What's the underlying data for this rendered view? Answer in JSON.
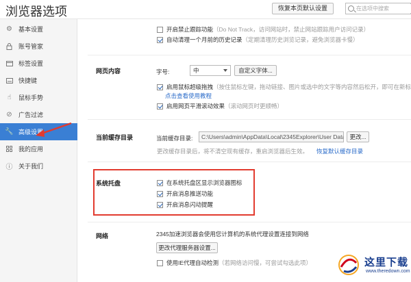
{
  "header": {
    "title": "浏览器选项",
    "reset_label": "恢复本页默认设置",
    "search_placeholder": "在选项中搜索"
  },
  "sidebar": {
    "items": [
      {
        "label": "基本设置",
        "icon": "gear-icon"
      },
      {
        "label": "账号管家",
        "icon": "lock-icon"
      },
      {
        "label": "标签设置",
        "icon": "tab-icon"
      },
      {
        "label": "快捷键",
        "icon": "keyboard-icon"
      },
      {
        "label": "鼠标手势",
        "icon": "hand-icon"
      },
      {
        "label": "广告过滤",
        "icon": "block-icon"
      },
      {
        "label": "高级设置",
        "icon": "wrench-icon"
      },
      {
        "label": "我的应用",
        "icon": "grid-icon"
      },
      {
        "label": "关于我们",
        "icon": "info-icon"
      }
    ],
    "active_index": 6
  },
  "privacy": {
    "dnt": {
      "checked": false,
      "label": "开启禁止跟踪功能",
      "hint": "（Do Not Track，访问网站时，禁止网站跟踪用户访问记录）"
    },
    "clear": {
      "checked": true,
      "label": "自动清理一个月前的历史记录",
      "hint": "（定期清理历史浏览记录，避免浏览器卡慢）"
    }
  },
  "webcontent": {
    "title": "网页内容",
    "font_label": "字号:",
    "font_value": "中",
    "custom_font": "自定义字体...",
    "drag": {
      "checked": true,
      "label": "启用鼠标超级拖拽",
      "hint": "（按住鼠标左键，拖动链接、图片或选中的文字等内容然后松开，即可在新标",
      "link": "点击查看使用教程"
    },
    "smooth": {
      "checked": true,
      "label": "启用网页平滑滚动效果",
      "hint": "（滚动网页时更顺畅）"
    }
  },
  "cache": {
    "title": "当前缓存目录",
    "dir_label": "当前缓存目录:",
    "path": "C:\\Users\\admin\\AppData\\Local\\2345Explorer\\User Data",
    "change": "更改...",
    "note": "更改缓存目录后，将不清空现有缓存，重启浏览器后生效。",
    "restore": "恢复默认缓存目录"
  },
  "tray": {
    "title": "系统托盘",
    "items": [
      {
        "checked": true,
        "label": "在系统托盘区显示浏览器图标"
      },
      {
        "checked": true,
        "label": "开启消息推送功能"
      },
      {
        "checked": true,
        "label": "开启消息闪动提醒"
      }
    ]
  },
  "network": {
    "title": "网络",
    "desc": "2345加速浏览器会使用您计算机的系统代理设置连接到网络",
    "proxy_btn": "更改代理服务器设置...",
    "ie_proxy": {
      "checked": false,
      "label": "使用IE代理自动检测",
      "hint": "（若网络访问慢，可尝试勾选此项）"
    }
  },
  "watermark": {
    "text": "这里下载",
    "url": "www.theredown.com"
  },
  "colors": {
    "active": "#3a7fd4",
    "highlight": "#e23a2e",
    "link": "#2a6bc9"
  }
}
